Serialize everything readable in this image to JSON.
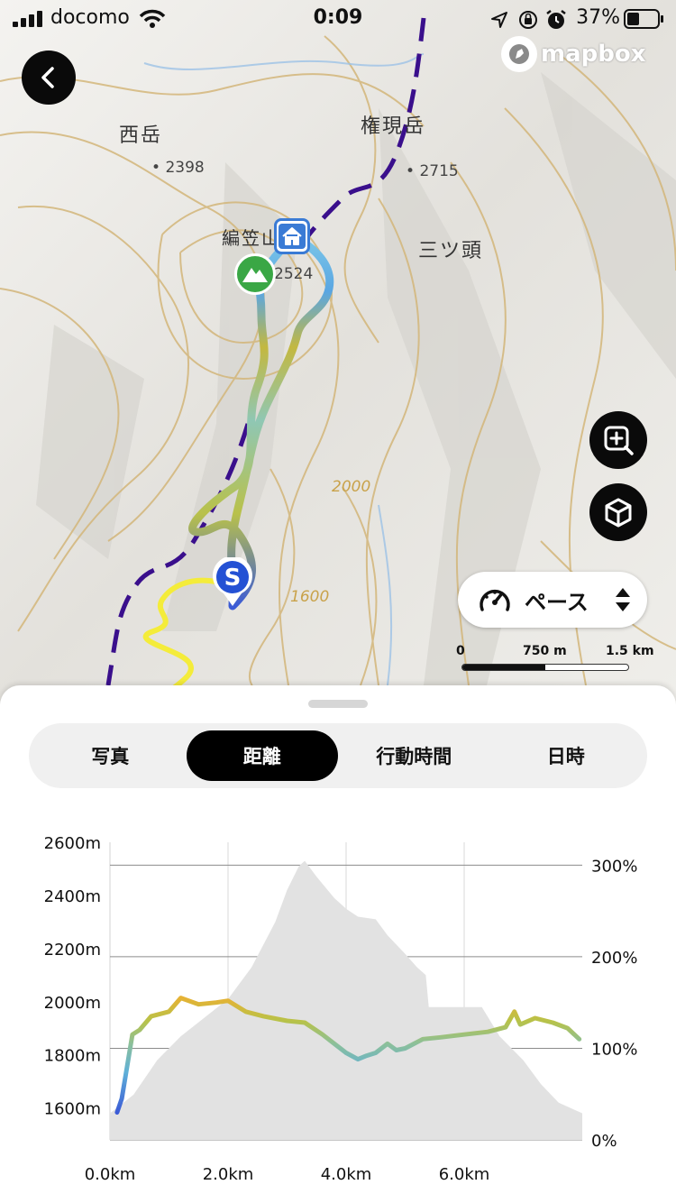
{
  "status_bar": {
    "carrier": "docomo",
    "time": "0:09",
    "battery": "37%"
  },
  "map": {
    "attribution": "mapbox",
    "peak_labels": [
      "西岳",
      "権現岳",
      "編笠山",
      "三ツ頭"
    ],
    "elevation_labels": [
      "2398",
      "2715",
      "2524"
    ],
    "contour_labels": [
      "2000",
      "1600"
    ],
    "pace_selector": {
      "label": "ペース"
    },
    "scale_bar": {
      "ticks": [
        "0",
        "750 m",
        "1.5 km"
      ]
    },
    "colors": {
      "route_low": "#3b5bd6",
      "route_mid": "#7cc7d8",
      "route_high": "#e8b935",
      "trail_yellow": "#f4ec3a",
      "trail_purple": "#3a0f8c"
    }
  },
  "sheet": {
    "tabs": [
      {
        "label": "写真",
        "active": false
      },
      {
        "label": "距離",
        "active": true
      },
      {
        "label": "行動時間",
        "active": false
      },
      {
        "label": "日時",
        "active": false
      }
    ]
  },
  "chart_data": {
    "type": "area",
    "x_tick_labels": [
      "0.0km",
      "2.0km",
      "4.0km",
      "6.0km"
    ],
    "left_tick_labels": [
      "2600m",
      "2400m",
      "2200m",
      "2000m",
      "1800m",
      "1600m"
    ],
    "right_tick_labels": [
      "300%",
      "200%",
      "100%",
      "0%"
    ],
    "xlim": [
      0,
      8.0
    ],
    "ylim": [
      1480,
      2600
    ],
    "pct_lim": [
      0,
      325
    ],
    "series": [
      {
        "kind": "elevation-area",
        "x": [
          0.0,
          0.4,
          0.8,
          1.2,
          1.6,
          2.0,
          2.4,
          2.8,
          3.0,
          3.2,
          3.3,
          3.5,
          3.8,
          4.0,
          4.2,
          4.5,
          4.7,
          5.0,
          5.2,
          5.35,
          5.4,
          6.3,
          6.6,
          7.0,
          7.3,
          7.6,
          8.0
        ],
        "y": [
          1580,
          1650,
          1780,
          1870,
          1940,
          2010,
          2130,
          2300,
          2420,
          2510,
          2530,
          2470,
          2390,
          2350,
          2320,
          2310,
          2250,
          2180,
          2130,
          2100,
          1980,
          1980,
          1870,
          1780,
          1690,
          1620,
          1580
        ]
      },
      {
        "kind": "pace-line",
        "x": [
          0.12,
          0.2,
          0.38,
          0.5,
          0.7,
          1.0,
          1.2,
          1.5,
          1.8,
          2.0,
          2.3,
          2.6,
          3.0,
          3.3,
          3.6,
          3.8,
          4.0,
          4.2,
          4.35,
          4.5,
          4.7,
          4.85,
          5.0,
          5.3,
          5.6,
          6.0,
          6.4,
          6.7,
          6.85,
          6.95,
          7.2,
          7.5,
          7.75,
          7.95
        ],
        "y": [
          30,
          45,
          115,
          120,
          135,
          140,
          155,
          148,
          150,
          152,
          140,
          135,
          130,
          128,
          115,
          105,
          95,
          88,
          92,
          95,
          105,
          98,
          100,
          110,
          112,
          115,
          118,
          123,
          140,
          126,
          133,
          128,
          122,
          110
        ]
      }
    ]
  }
}
